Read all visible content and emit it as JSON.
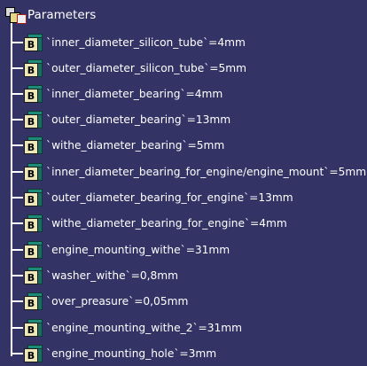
{
  "tree": {
    "root_label": "Parameters",
    "items": [
      {
        "label": "`inner_diameter_silicon_tube`=4mm",
        "icon": "parameter-icon",
        "icon_letter": "B"
      },
      {
        "label": "`outer_diameter_silicon_tube`=5mm",
        "icon": "parameter-icon",
        "icon_letter": "B"
      },
      {
        "label": "`inner_diameter_bearing`=4mm",
        "icon": "parameter-icon",
        "icon_letter": "B"
      },
      {
        "label": "`outer_diameter_bearing`=13mm",
        "icon": "parameter-icon",
        "icon_letter": "B"
      },
      {
        "label": "`withe_diameter_bearing`=5mm",
        "icon": "parameter-icon",
        "icon_letter": "B"
      },
      {
        "label": "`inner_diameter_bearing_for_engine/engine_mount`=5mm",
        "icon": "parameter-icon",
        "icon_letter": "B"
      },
      {
        "label": "`outer_diameter_bearing_for_engine`=13mm",
        "icon": "parameter-icon",
        "icon_letter": "B"
      },
      {
        "label": "`withe_diameter_bearing_for_engine`=4mm",
        "icon": "parameter-icon",
        "icon_letter": "B"
      },
      {
        "label": "`engine_mounting_withe`=31mm",
        "icon": "parameter-icon",
        "icon_letter": "B"
      },
      {
        "label": "`washer_withe`=0,8mm",
        "icon": "parameter-icon",
        "icon_letter": "B"
      },
      {
        "label": "`over_preasure`=0,05mm",
        "icon": "parameter-icon",
        "icon_letter": "B"
      },
      {
        "label": "`engine_mounting_withe_2`=31mm",
        "icon": "parameter-icon",
        "icon_letter": "B"
      },
      {
        "label": "`engine_mounting_hole`=3mm",
        "icon": "parameter-icon",
        "icon_letter": "B"
      }
    ]
  },
  "colors": {
    "background": "#333366",
    "text": "#ffffff",
    "tree_line": "#ffffff"
  }
}
